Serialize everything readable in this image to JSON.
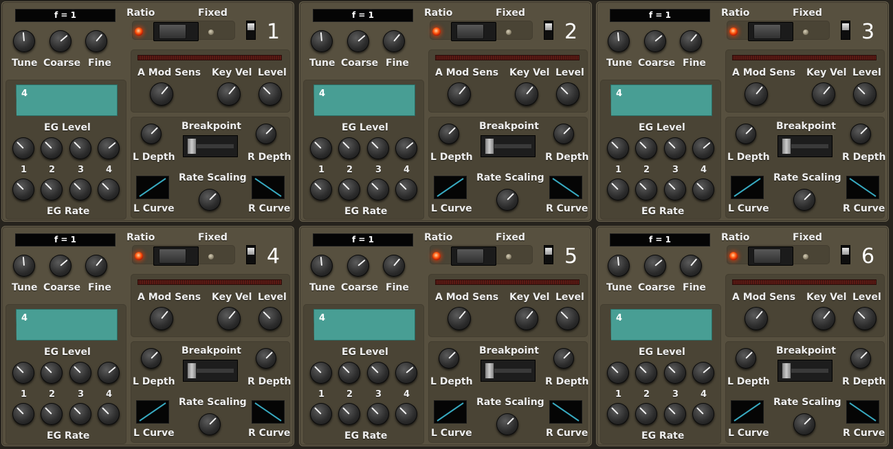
{
  "labels": {
    "ratio": "Ratio",
    "fixed": "Fixed",
    "tune": "Tune",
    "coarse": "Coarse",
    "fine": "Fine",
    "a_mod_sens": "A Mod Sens",
    "key_vel": "Key Vel",
    "level": "Level",
    "eg_level": "EG Level",
    "eg_rate": "EG Rate",
    "breakpoint": "Breakpoint",
    "l_depth": "L Depth",
    "r_depth": "R Depth",
    "rate_scaling": "Rate Scaling",
    "l_curve": "L Curve",
    "r_curve": "R Curve",
    "stage_numbers": [
      "1",
      "2",
      "3",
      "4"
    ]
  },
  "colors": {
    "panel": "#57503f",
    "eg_display": "#489e94",
    "curve_line": "#37a9c0",
    "led_on": "#ff4a10"
  },
  "operators": [
    {
      "number": "1",
      "freq_display": "f = 1",
      "eg_display_value": "4",
      "mode": "Ratio",
      "l_curve": "rising",
      "r_curve": "falling"
    },
    {
      "number": "2",
      "freq_display": "f = 1",
      "eg_display_value": "4",
      "mode": "Ratio",
      "l_curve": "rising",
      "r_curve": "falling"
    },
    {
      "number": "3",
      "freq_display": "f = 1",
      "eg_display_value": "4",
      "mode": "Ratio",
      "l_curve": "rising",
      "r_curve": "falling"
    },
    {
      "number": "4",
      "freq_display": "f = 1",
      "eg_display_value": "4",
      "mode": "Ratio",
      "l_curve": "rising",
      "r_curve": "falling"
    },
    {
      "number": "5",
      "freq_display": "f = 1",
      "eg_display_value": "4",
      "mode": "Ratio",
      "l_curve": "rising",
      "r_curve": "falling"
    },
    {
      "number": "6",
      "freq_display": "f = 1",
      "eg_display_value": "4",
      "mode": "Ratio",
      "l_curve": "rising",
      "r_curve": "falling"
    }
  ]
}
